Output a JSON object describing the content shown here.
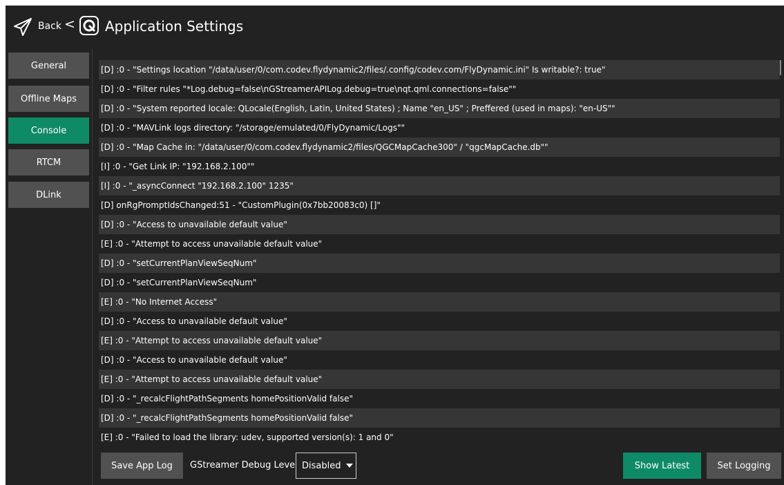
{
  "header": {
    "back_label": "Back",
    "chevron": "<",
    "title": "Application Settings"
  },
  "sidebar": {
    "items": [
      {
        "label": "General",
        "active": false
      },
      {
        "label": "Offline Maps",
        "active": false
      },
      {
        "label": "Console",
        "active": true
      },
      {
        "label": "RTCM",
        "active": false
      },
      {
        "label": "DLink",
        "active": false
      }
    ]
  },
  "console": {
    "lines": [
      "[D] :0 - \"Settings location \"/data/user/0/com.codev.flydynamic2/files/.config/codev.com/FlyDynamic.ini\" Is writable?: true\"",
      "[D] :0 - \"Filter rules \"*Log.debug=false\\nGStreamerAPILog.debug=true\\nqt.qml.connections=false\"\"",
      "[D] :0 - \"System reported locale: QLocale(English, Latin, United States) ; Name \"en_US\" ; Preffered (used in maps):  \"en-US\"\"",
      "[D] :0 - \"MAVLink logs directory: \"/storage/emulated/0/FlyDynamic/Logs\"\"",
      "[D] :0 - \"Map Cache in: \"/data/user/0/com.codev.flydynamic2/files/QGCMapCache300\" / \"qgcMapCache.db\"\"",
      "[I] :0 - \"Get Link IP: \"192.168.2.100\"\"",
      "[I] :0 - \"_asyncConnect \"192.168.2.100\" 1235\"",
      "[D] onRgPromptIdsChanged:51 - \"CustomPlugin(0x7bb20083c0) []\"",
      "[D] :0 - \"Access to unavailable default value\"",
      "[E] :0 - \"Attempt to access unavailable default value\"",
      "[D] :0 - \"setCurrentPlanViewSeqNum\"",
      "[D] :0 - \"setCurrentPlanViewSeqNum\"",
      "[E] :0 - \"No Internet Access\"",
      "[D] :0 - \"Access to unavailable default value\"",
      "[E] :0 - \"Attempt to access unavailable default value\"",
      "[D] :0 - \"Access to unavailable default value\"",
      "[E] :0 - \"Attempt to access unavailable default value\"",
      "[D] :0 - \"_recalcFlightPathSegments homePositionValid false\"",
      "[D] :0 - \"_recalcFlightPathSegments homePositionValid false\"",
      "[E] :0 - \"Failed to load the library: udev, supported version(s): 1 and 0\""
    ]
  },
  "footer": {
    "save_label": "Save App Log",
    "gst_label": "GStreamer Debug Level",
    "gst_value": "Disabled",
    "show_latest_label": "Show Latest",
    "set_logging_label": "Set Logging"
  },
  "colors": {
    "accent": "#0f8a67",
    "button": "#515151",
    "background": "#222222",
    "row_alt": "#363636"
  },
  "icons": {
    "back": "paper-plane-icon",
    "app": "app-logo-icon",
    "dropdown": "caret-down-icon"
  }
}
